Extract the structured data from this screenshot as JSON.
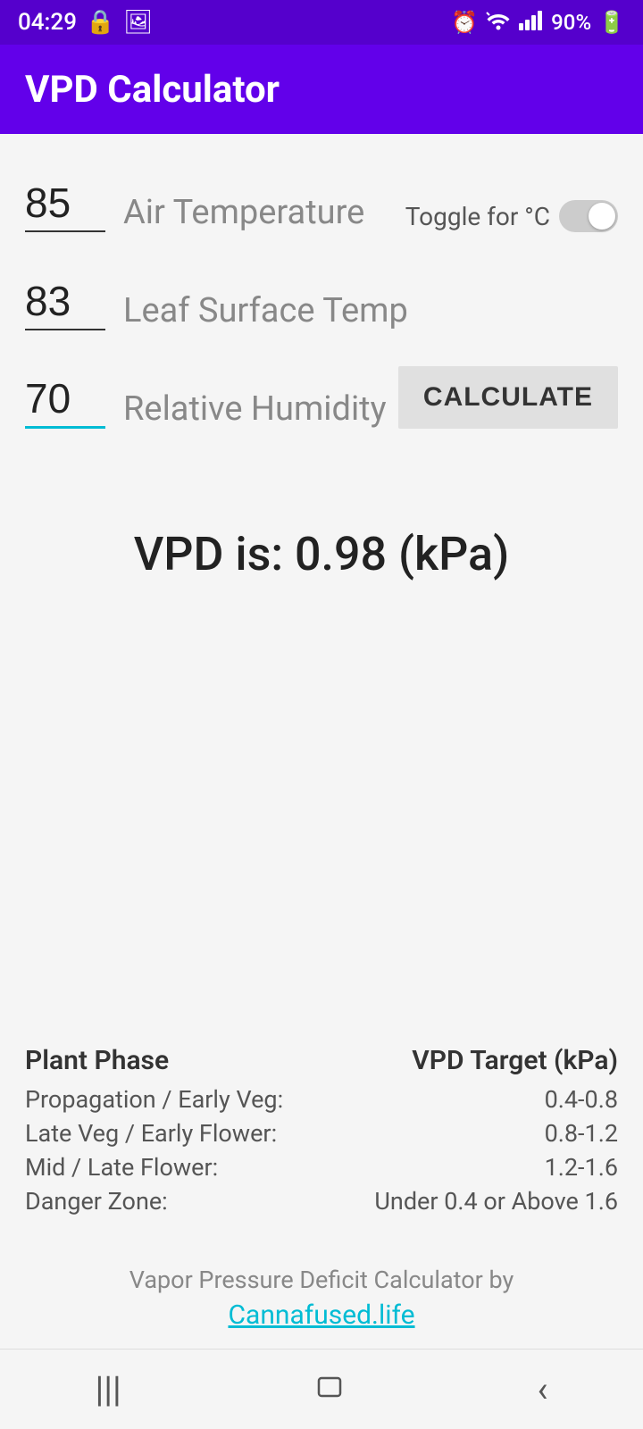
{
  "status": {
    "time": "04:29",
    "battery": "90%"
  },
  "app": {
    "title": "VPD Calculator"
  },
  "inputs": {
    "air_temp": {
      "value": "85",
      "label": "Air Temperature"
    },
    "leaf_temp": {
      "value": "83",
      "label": "Leaf Surface Temp"
    },
    "humidity": {
      "value": "70",
      "label": "Relative Humidity"
    }
  },
  "toggle": {
    "label": "Toggle for °C"
  },
  "calculate_btn": "CALCULATE",
  "result": {
    "label": "VPD is: 0.98 (kPa)"
  },
  "table": {
    "col1_header": "Plant Phase",
    "col2_header": "VPD Target (kPa)",
    "rows": [
      {
        "phase": "Propagation / Early Veg:",
        "target": "0.4-0.8"
      },
      {
        "phase": "Late Veg / Early Flower:",
        "target": "0.8-1.2"
      },
      {
        "phase": "Mid / Late Flower:",
        "target": "1.2-1.6"
      },
      {
        "phase": "Danger Zone:",
        "target": "Under 0.4 or Above 1.6"
      }
    ]
  },
  "footer": {
    "text": "Vapor Pressure Deficit Calculator by",
    "link": "Cannafused.life"
  }
}
